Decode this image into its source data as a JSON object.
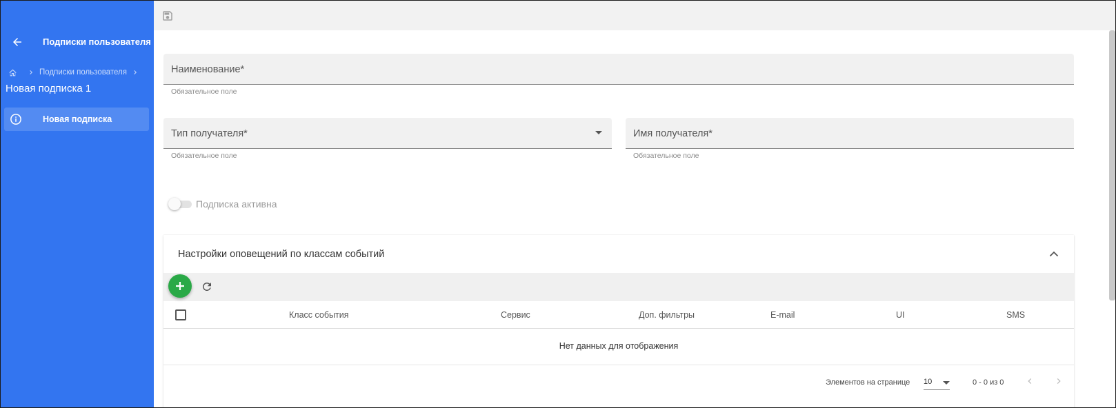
{
  "sidebar": {
    "title": "Подписки пользователя",
    "breadcrumb": {
      "item": "Подписки пользователя"
    },
    "current": "Новая подписка 1",
    "items": [
      {
        "label": "Новая подписка",
        "icon": "info-icon"
      }
    ],
    "color": "#3375f0"
  },
  "toolbar": {
    "save_icon": "save-icon"
  },
  "form": {
    "name": {
      "placeholder": "Наименование*",
      "hint": "Обязательное поле"
    },
    "recipient_type": {
      "placeholder": "Тип получателя*",
      "hint": "Обязательное поле"
    },
    "recipient_name": {
      "placeholder": "Имя получателя*",
      "hint": "Обязательное поле"
    },
    "active_toggle": {
      "label": "Подписка активна",
      "checked": false
    }
  },
  "panel": {
    "title": "Настройки оповещений по классам событий",
    "columns": [
      "Класс события",
      "Сервис",
      "Доп. фильтры",
      "E-mail",
      "UI",
      "SMS"
    ],
    "empty_text": "Нет данных для отображения",
    "add_color": "#2aa947"
  },
  "paginator": {
    "label": "Элементов на странице",
    "page_size": "10",
    "range": "0 - 0 из 0"
  }
}
